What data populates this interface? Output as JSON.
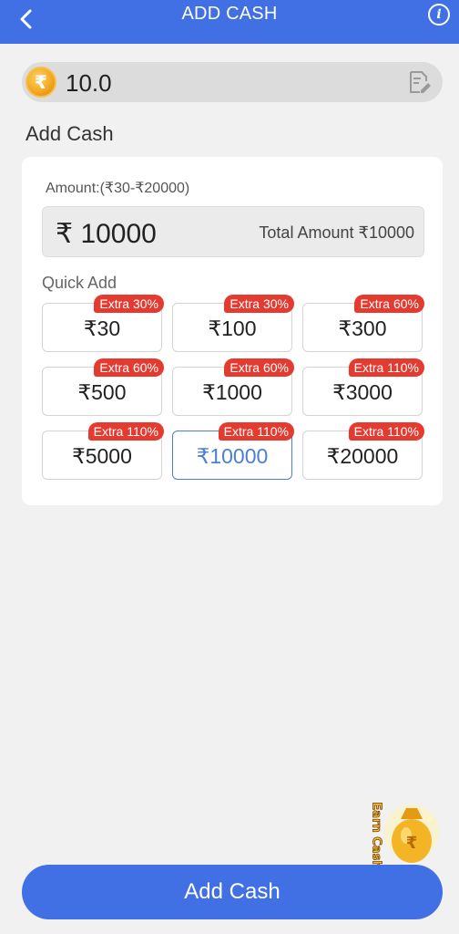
{
  "header": {
    "title": "ADD CASH",
    "back_icon": "chevron-left-icon",
    "info_icon": "info-icon"
  },
  "balance": {
    "value": "10.0",
    "coin_symbol": "₹",
    "coin_icon": "rupee-coin-icon",
    "edit_icon": "edit-document-icon"
  },
  "section_title": "Add Cash",
  "card": {
    "range_label": "Amount:(₹30-₹20000)",
    "amount_symbol": "₹",
    "amount_value": "10000",
    "total_label": "Total Amount ₹10000",
    "quick_add_label": "Quick Add",
    "options": [
      {
        "value": "₹30",
        "badge": "Extra 30%",
        "selected": false
      },
      {
        "value": "₹100",
        "badge": "Extra 30%",
        "selected": false
      },
      {
        "value": "₹300",
        "badge": "Extra 60%",
        "selected": false
      },
      {
        "value": "₹500",
        "badge": "Extra 60%",
        "selected": false
      },
      {
        "value": "₹1000",
        "badge": "Extra 60%",
        "selected": false
      },
      {
        "value": "₹3000",
        "badge": "Extra 110%",
        "selected": false
      },
      {
        "value": "₹5000",
        "badge": "Extra 110%",
        "selected": false
      },
      {
        "value": "₹10000",
        "badge": "Extra 110%",
        "selected": true
      },
      {
        "value": "₹20000",
        "badge": "Extra 110%",
        "selected": false
      }
    ]
  },
  "earn_cash": {
    "label": "Earn Cash",
    "icon": "money-bag-icon"
  },
  "add_button": {
    "label": "Add Cash"
  },
  "colors": {
    "primary": "#4070e3",
    "badge": "#e43b30",
    "selected_border": "#4a7fd8",
    "background": "#f1f1f1"
  }
}
